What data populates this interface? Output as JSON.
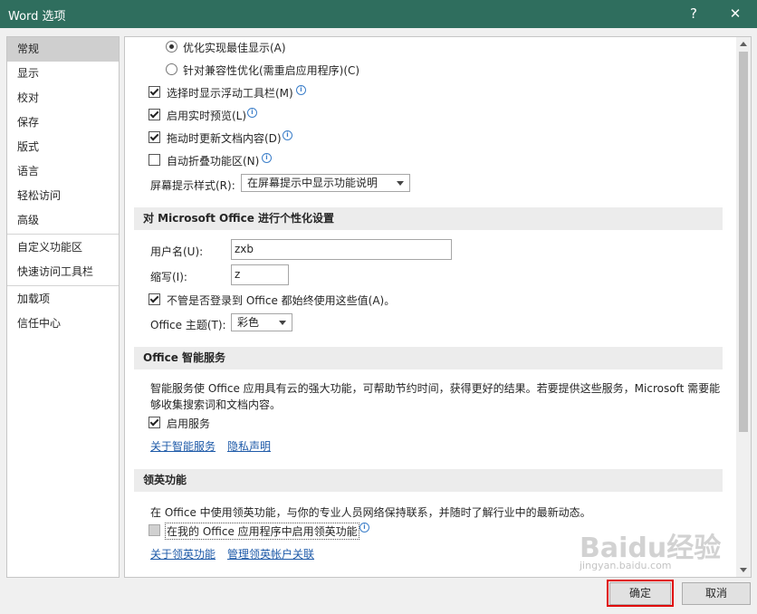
{
  "window": {
    "title": "Word 选项",
    "help": "?",
    "close": "✕"
  },
  "nav": {
    "items": [
      "常规",
      "显示",
      "校对",
      "保存",
      "版式",
      "语言",
      "轻松访问",
      "高级",
      "自定义功能区",
      "快速访问工具栏",
      "加载项",
      "信任中心"
    ],
    "active_index": 0
  },
  "general": {
    "radio_best": "优化实现最佳显示(A)",
    "radio_compat": "针对兼容性优化(需重启应用程序)(C)",
    "cb_minitoolbar": "选择时显示浮动工具栏(M)",
    "cb_livepreview": "启用实时预览(L)",
    "cb_dragupdate": "拖动时更新文档内容(D)",
    "cb_collapse": "自动折叠功能区(N)",
    "tooltip_label": "屏幕提示样式(R):",
    "tooltip_value": "在屏幕提示中显示功能说明"
  },
  "personalize": {
    "header": "对 Microsoft Office 进行个性化设置",
    "username_label": "用户名(U):",
    "username_value": "zxb",
    "initials_label": "缩写(I):",
    "initials_value": "z",
    "always_use": "不管是否登录到 Office 都始终使用这些值(A)。",
    "theme_label": "Office 主题(T):",
    "theme_value": "彩色"
  },
  "intelligent": {
    "header": "Office 智能服务",
    "desc_line1": "智能服务使 Office 应用具有云的强大功能，可帮助节约时间，获得更好的结果。若要提供这些服务，Microsoft 需要能",
    "desc_line2": "够收集搜索词和文档内容。",
    "enable": "启用服务",
    "about_link": "关于智能服务",
    "privacy_link": "隐私声明"
  },
  "linkedin": {
    "header": "领英功能",
    "desc": "在 Office 中使用领英功能，与你的专业人员网络保持联系，并随时了解行业中的最新动态。",
    "enable": "在我的 Office 应用程序中启用领英功能",
    "about_link": "关于领英功能",
    "manage_link": "管理领英帐户关联"
  },
  "footer": {
    "ok": "确定",
    "cancel": "取消"
  },
  "watermark": {
    "main": "Baidu经验",
    "sub": "jingyan.baidu.com"
  },
  "colors": {
    "titlebar": "#2f6e5e",
    "link": "#1e5aa8",
    "highlight": "#e00000"
  }
}
